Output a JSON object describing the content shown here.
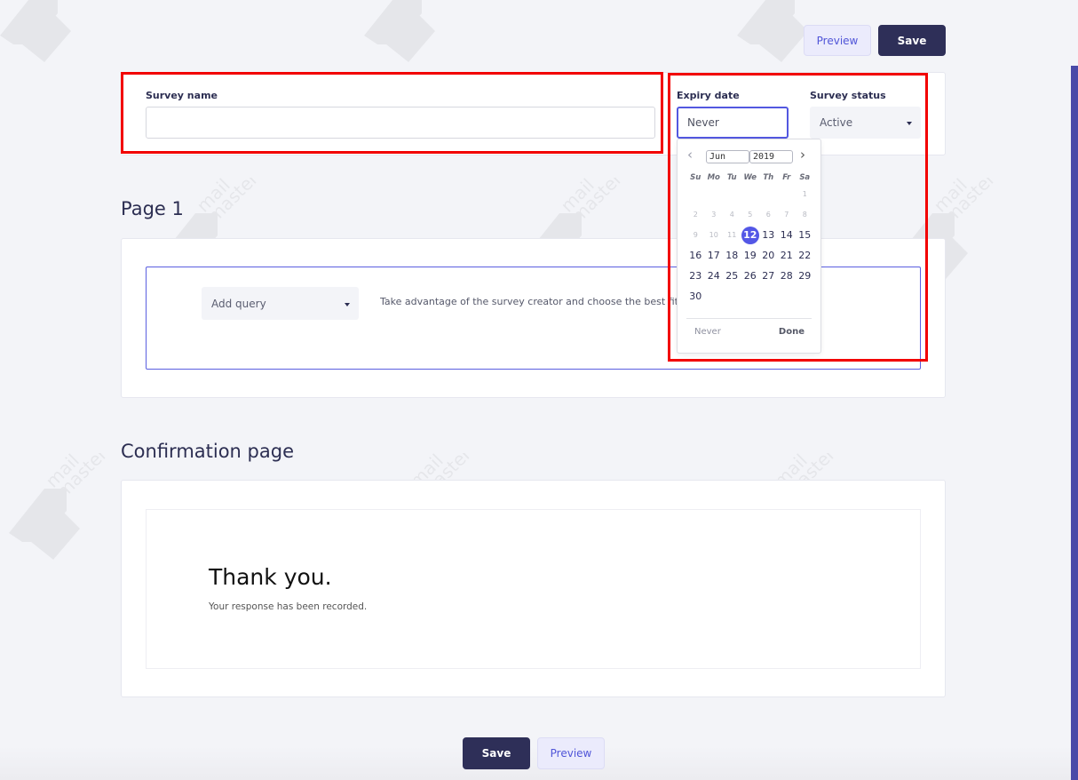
{
  "brand": {
    "watermark": "mail master",
    "accent": "#5357e6",
    "dark": "#2e2f58",
    "highlight_color": "#f20000"
  },
  "top_toolbar": {
    "preview_label": "Preview",
    "save_label": "Save"
  },
  "survey_settings": {
    "name_label": "Survey name",
    "name_value": "",
    "expiry_label": "Expiry date",
    "expiry_value": "Never",
    "status_label": "Survey status",
    "status_value": "Active"
  },
  "datepicker": {
    "month": "Jun",
    "year": "2019",
    "weekdays": [
      "Su",
      "Mo",
      "Tu",
      "We",
      "Th",
      "Fr",
      "Sa"
    ],
    "weeks": [
      [
        "",
        "",
        "",
        "",
        "",
        "",
        "1"
      ],
      [
        "2",
        "3",
        "4",
        "5",
        "6",
        "7",
        "8"
      ],
      [
        "9",
        "10",
        "11",
        "12",
        "13",
        "14",
        "15"
      ],
      [
        "16",
        "17",
        "18",
        "19",
        "20",
        "21",
        "22"
      ],
      [
        "23",
        "24",
        "25",
        "26",
        "27",
        "28",
        "29"
      ],
      [
        "30",
        "",
        "",
        "",
        "",
        "",
        ""
      ]
    ],
    "disabled_through": 11,
    "selected_day": "12",
    "never_label": "Never",
    "done_label": "Done"
  },
  "page1": {
    "title": "Page 1",
    "add_query_label": "Add query",
    "hint": "Take advantage of the survey creator and choose the best fitting"
  },
  "confirmation": {
    "title": "Confirmation page",
    "heading": "Thank you.",
    "message": "Your response has been recorded."
  },
  "bottom_toolbar": {
    "save_label": "Save",
    "preview_label": "Preview"
  }
}
